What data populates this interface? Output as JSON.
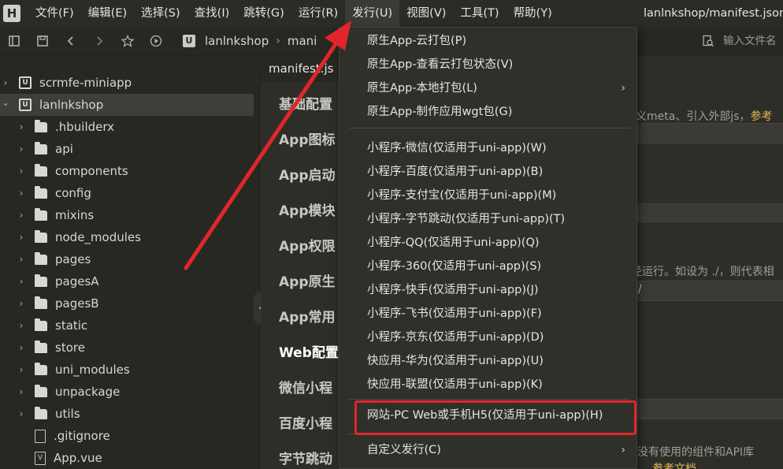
{
  "menubar": {
    "logo": "H",
    "items": [
      "文件(F)",
      "编辑(E)",
      "选择(S)",
      "查找(I)",
      "跳转(G)",
      "运行(R)",
      "发行(U)",
      "视图(V)",
      "工具(T)",
      "帮助(Y)"
    ],
    "active_index": 6,
    "window_title": "lanlnkshop/manifest.json - "
  },
  "toolbar": {
    "breadcrumb_logo": "U",
    "breadcrumb": [
      "lanlnkshop",
      "mani"
    ],
    "search_placeholder": "输入文件名"
  },
  "sidebar": {
    "items": [
      {
        "label": "scrmfe-miniapp",
        "type": "project",
        "expanded": false,
        "depth": 0
      },
      {
        "label": "lanlnkshop",
        "type": "project",
        "expanded": true,
        "depth": 0,
        "selected": true
      },
      {
        "label": ".hbuilderx",
        "type": "folder",
        "depth": 1
      },
      {
        "label": "api",
        "type": "folder",
        "depth": 1
      },
      {
        "label": "components",
        "type": "folder",
        "depth": 1
      },
      {
        "label": "config",
        "type": "folder",
        "depth": 1
      },
      {
        "label": "mixins",
        "type": "folder",
        "depth": 1
      },
      {
        "label": "node_modules",
        "type": "folder",
        "depth": 1
      },
      {
        "label": "pages",
        "type": "folder",
        "depth": 1
      },
      {
        "label": "pagesA",
        "type": "folder",
        "depth": 1
      },
      {
        "label": "pagesB",
        "type": "folder",
        "depth": 1
      },
      {
        "label": "static",
        "type": "folder",
        "depth": 1
      },
      {
        "label": "store",
        "type": "folder",
        "depth": 1
      },
      {
        "label": "uni_modules",
        "type": "folder",
        "depth": 1
      },
      {
        "label": "unpackage",
        "type": "folder",
        "depth": 1
      },
      {
        "label": "utils",
        "type": "folder",
        "depth": 1
      },
      {
        "label": ".gitignore",
        "type": "file",
        "depth": 1
      },
      {
        "label": "App.vue",
        "type": "vue",
        "depth": 1
      }
    ]
  },
  "editor": {
    "tab_label": "manifest.js",
    "nav_items": [
      "基础配置",
      "App图标",
      "App启动",
      "App模块",
      "App权限",
      "App原生",
      "App常用",
      "Web配置",
      "微信小程",
      "百度小程",
      "字节跳动"
    ],
    "active_nav_index": 7,
    "content_fragments": {
      "meta_text": "定义meta、引入外部js，",
      "meta_link": "参考",
      "run_text": "径运行。如设为 ./，则代表相",
      "slash": "/",
      "components_text": "没有使用的组件和API库",
      "docs_link": "参考文档"
    }
  },
  "dropdown": {
    "groups": [
      [
        {
          "label": "原生App-云打包(P)"
        },
        {
          "label": "原生App-查看云打包状态(V)"
        },
        {
          "label": "原生App-本地打包(L)",
          "submenu": true
        },
        {
          "label": "原生App-制作应用wgt包(G)"
        }
      ],
      [
        {
          "label": "小程序-微信(仅适用于uni-app)(W)"
        },
        {
          "label": "小程序-百度(仅适用于uni-app)(B)"
        },
        {
          "label": "小程序-支付宝(仅适用于uni-app)(M)"
        },
        {
          "label": "小程序-字节跳动(仅适用于uni-app)(T)"
        },
        {
          "label": "小程序-QQ(仅适用于uni-app)(Q)"
        },
        {
          "label": "小程序-360(仅适用于uni-app)(S)"
        },
        {
          "label": "小程序-快手(仅适用于uni-app)(J)"
        },
        {
          "label": "小程序-飞书(仅适用于uni-app)(F)"
        },
        {
          "label": "小程序-京东(仅适用于uni-app)(D)"
        },
        {
          "label": "快应用-华为(仅适用于uni-app)(U)"
        },
        {
          "label": "快应用-联盟(仅适用于uni-app)(K)"
        }
      ],
      [
        {
          "label": "网站-PC Web或手机H5(仅适用于uni-app)(H)",
          "highlighted": true
        }
      ],
      [
        {
          "label": "自定义发行(C)",
          "submenu": true
        }
      ]
    ],
    "submenu_arrow": "›"
  },
  "colors": {
    "annotation_red": "#e0262c",
    "background": "#272822",
    "menu_bg": "#2f302a"
  }
}
